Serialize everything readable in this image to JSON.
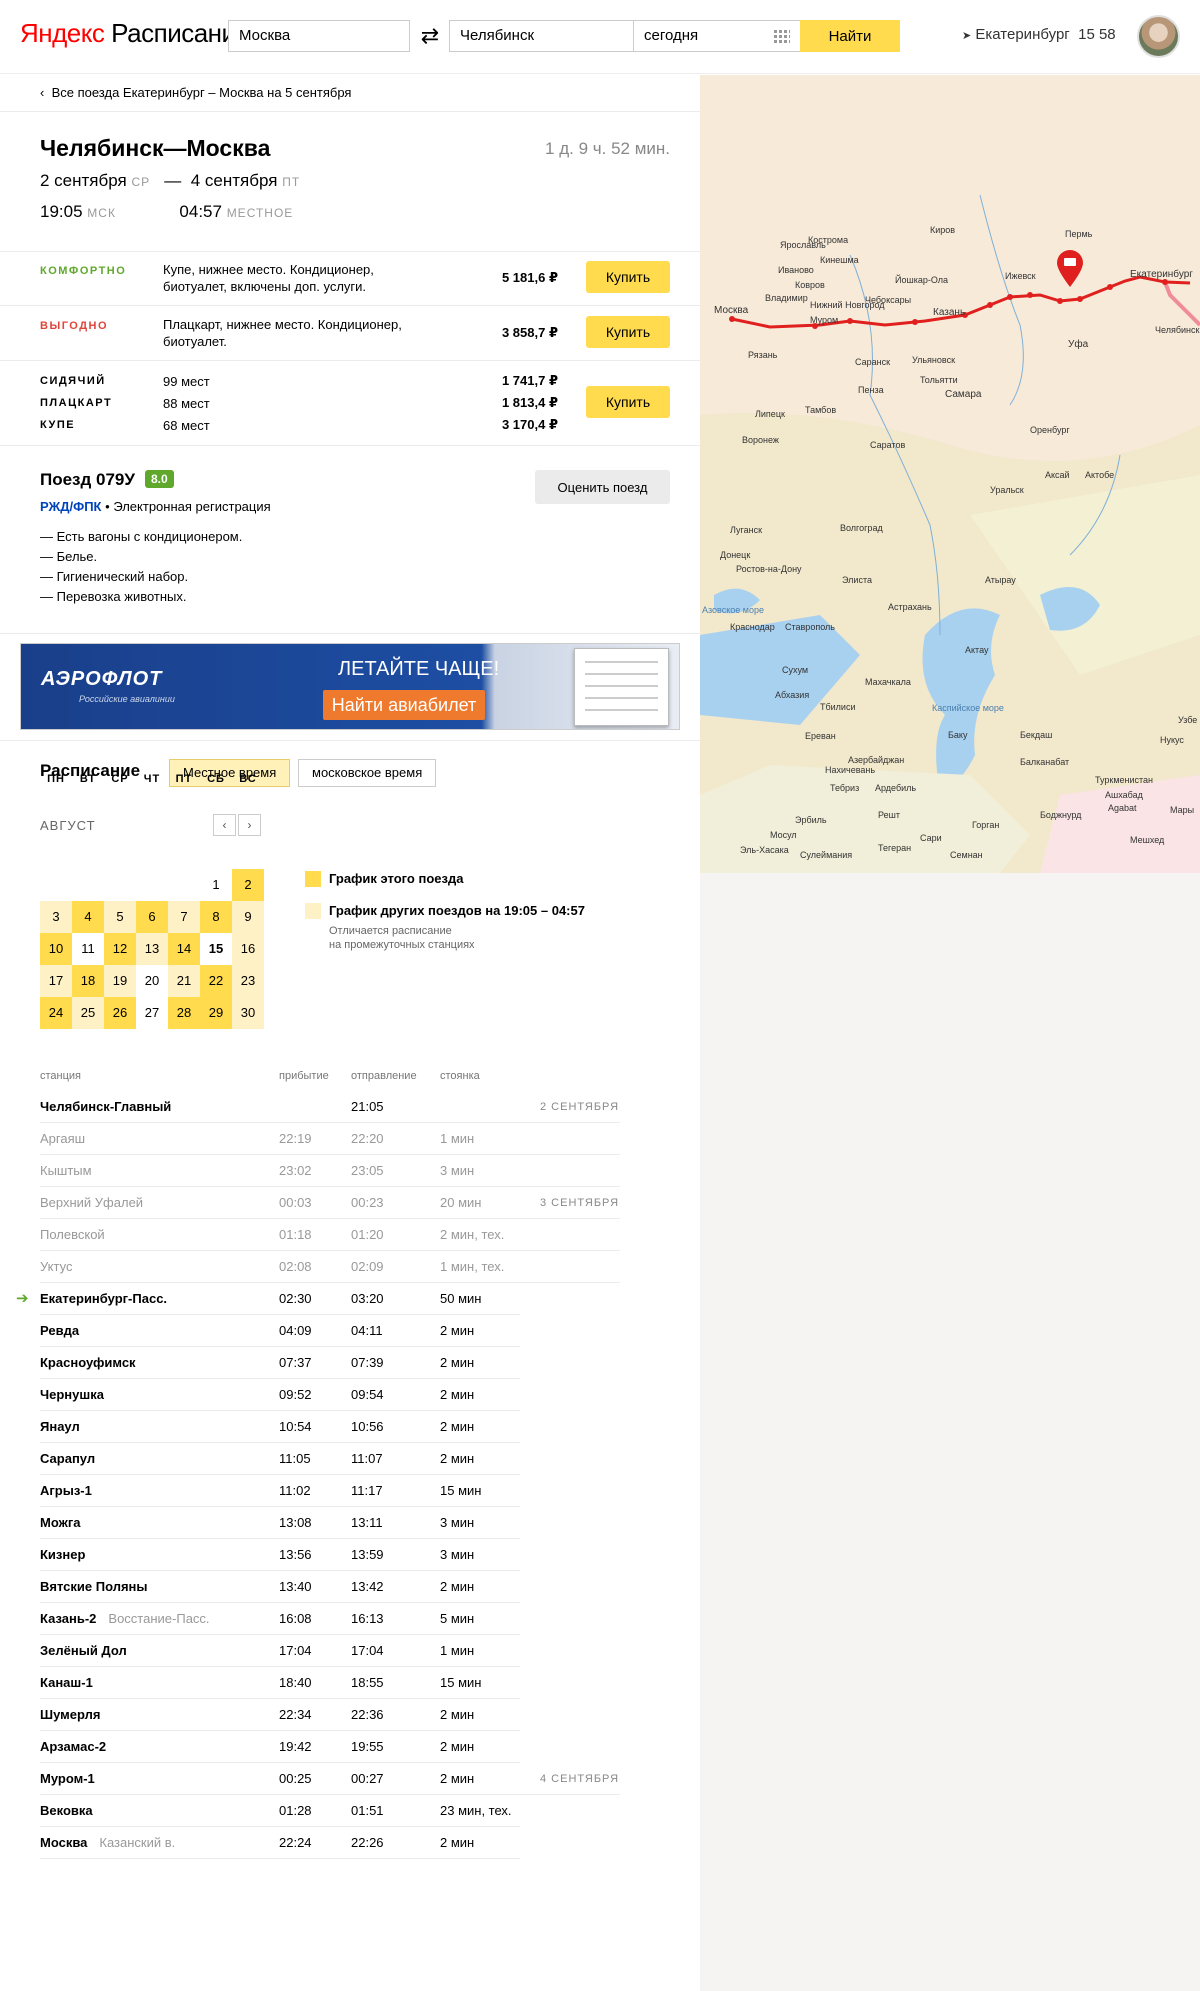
{
  "header": {
    "logo_brand": "Яндекс",
    "logo_service": "Расписания",
    "from_value": "Москва",
    "to_value": "Челябинск",
    "date_value": "сегодня",
    "find_label": "Найти",
    "city": "Екатеринбург",
    "time": "15 58"
  },
  "back_link": "Все поезда Екатеринбург – Москва на 5 сентября",
  "trip": {
    "title": "Челябинск—Москва",
    "duration": "1 д. 9 ч. 52 мин.",
    "dep_date": "2 сентября",
    "dep_dow": "СР",
    "dash": "—",
    "arr_date": "4 сентября",
    "arr_dow": "ПТ",
    "dep_time": "19:05",
    "dep_tz": "МСК",
    "arr_time": "04:57",
    "arr_tz": "МЕСТНОЕ"
  },
  "offers": [
    {
      "tag": "КОМФОРТНО",
      "color": "#5fa82b",
      "desc": "Купе, нижнее место. Кондиционер, биотуалет, включены доп. услуги.",
      "price": "5 181,6 ₽",
      "buy": "Купить"
    },
    {
      "tag": "ВЫГОДНО",
      "color": "#e0453b",
      "desc": "Плацкарт, нижнее место. Кондиционер, биотуалет.",
      "price": "3 858,7 ₽",
      "buy": "Купить"
    }
  ],
  "classes": {
    "rows": [
      {
        "name": "СИДЯЧИЙ",
        "seats": "99 мест",
        "price": "1 741,7 ₽"
      },
      {
        "name": "ПЛАЦКАРТ",
        "seats": "88 мест",
        "price": "1 813,4 ₽"
      },
      {
        "name": "КУПЕ",
        "seats": "68 мест",
        "price": "3 170,4 ₽"
      }
    ],
    "buy": "Купить"
  },
  "train": {
    "name": "Поезд 079У",
    "rating": "8.0",
    "carrier": "РЖД/ФПК",
    "bullet": "•",
    "reg": "Электронная регистрация",
    "features": [
      "— Есть вагоны с кондиционером.",
      "— Белье.",
      "— Гигиенический набор.",
      "— Перевозка животных."
    ],
    "rate_button": "Оценить поезд"
  },
  "banner": {
    "logo": "АЭРОФЛОТ",
    "sub": "Российские авиалинии",
    "headline": "ЛЕТАЙТЕ ЧАЩЕ!",
    "button": "Найти авиабилет"
  },
  "schedule": {
    "title": "Расписание",
    "toggle_local": "Местное время",
    "toggle_msk": "московское время",
    "month": "АВГУСТ",
    "prev": "‹",
    "next": "›",
    "dow": [
      "ПН",
      "ВТ",
      "СР",
      "ЧТ",
      "ПТ",
      "СБ",
      "ВС"
    ],
    "legend_this": "График этого поезда",
    "legend_other": "График  других поездов на 19:05 – 04:57",
    "legend_note1": "Отличается расписание",
    "legend_note2": "на промежуточных станциях"
  },
  "calendar": [
    {
      "d": "1",
      "c": "",
      "s": ""
    },
    {
      "d": "2",
      "c": "y",
      "s": ""
    },
    {
      "d": "3",
      "c": "l",
      "s": ""
    },
    {
      "d": "4",
      "c": "y",
      "s": ""
    },
    {
      "d": "5",
      "c": "l",
      "s": ""
    },
    {
      "d": "6",
      "c": "y",
      "s": ""
    },
    {
      "d": "7",
      "c": "l",
      "s": ""
    },
    {
      "d": "8",
      "c": "y",
      "s": ""
    },
    {
      "d": "9",
      "c": "l",
      "s": ""
    },
    {
      "d": "10",
      "c": "y",
      "s": ""
    },
    {
      "d": "11",
      "c": "",
      "s": ""
    },
    {
      "d": "12",
      "c": "y",
      "s": ""
    },
    {
      "d": "13",
      "c": "l",
      "s": ""
    },
    {
      "d": "14",
      "c": "y",
      "s": ""
    },
    {
      "d": "15",
      "c": "",
      "s": "b"
    },
    {
      "d": "16",
      "c": "l",
      "s": ""
    },
    {
      "d": "17",
      "c": "l",
      "s": ""
    },
    {
      "d": "18",
      "c": "y",
      "s": ""
    },
    {
      "d": "19",
      "c": "l",
      "s": ""
    },
    {
      "d": "20",
      "c": "",
      "s": ""
    },
    {
      "d": "21",
      "c": "l",
      "s": ""
    },
    {
      "d": "22",
      "c": "y",
      "s": ""
    },
    {
      "d": "23",
      "c": "l",
      "s": ""
    },
    {
      "d": "24",
      "c": "y",
      "s": ""
    },
    {
      "d": "25",
      "c": "l",
      "s": ""
    },
    {
      "d": "26",
      "c": "y",
      "s": ""
    },
    {
      "d": "27",
      "c": "",
      "s": ""
    },
    {
      "d": "28",
      "c": "y",
      "s": ""
    },
    {
      "d": "29",
      "c": "y",
      "s": ""
    },
    {
      "d": "30",
      "c": "l",
      "s": ""
    }
  ],
  "table": {
    "h_station": "станция",
    "h_arrival": "прибытие",
    "h_departure": "отправление",
    "h_stop": "стоянка",
    "rows": [
      {
        "st": "Челябинск-Главный",
        "sub": "",
        "arr": "",
        "dep": "21:05",
        "stop": "",
        "dt": "2 СЕНТЯБРЯ",
        "t": "bd"
      },
      {
        "st": "Аргаяш",
        "sub": "",
        "arr": "22:19",
        "dep": "22:20",
        "stop": "1 мин",
        "dt": "",
        "t": "gr"
      },
      {
        "st": "Кыштым",
        "sub": "",
        "arr": "23:02",
        "dep": "23:05",
        "stop": "3 мин",
        "dt": "",
        "t": "gr"
      },
      {
        "st": "Верхний Уфалей",
        "sub": "",
        "arr": "00:03",
        "dep": "00:23",
        "stop": "20 мин",
        "dt": "3 СЕНТЯБРЯ",
        "t": "gr"
      },
      {
        "st": "Полевской",
        "sub": "",
        "arr": "01:18",
        "dep": "01:20",
        "stop": "2 мин, тех.",
        "dt": "",
        "t": "gr"
      },
      {
        "st": "Уктус",
        "sub": "",
        "arr": "02:08",
        "dep": "02:09",
        "stop": "1 мин, тех.",
        "dt": "",
        "t": "gr"
      },
      {
        "st": "Екатеринбург-Пасс.",
        "sub": "",
        "arr": "02:30",
        "dep": "03:20",
        "stop": "50 мин",
        "dt": "",
        "t": "bd",
        "here": true
      },
      {
        "st": "Ревда",
        "sub": "",
        "arr": "04:09",
        "dep": "04:11",
        "stop": "2 мин",
        "dt": "",
        "t": "bd"
      },
      {
        "st": "Красноуфимск",
        "sub": "",
        "arr": "07:37",
        "dep": "07:39",
        "stop": "2 мин",
        "dt": "",
        "t": "bd"
      },
      {
        "st": "Чернушка",
        "sub": "",
        "arr": "09:52",
        "dep": "09:54",
        "stop": "2 мин",
        "dt": "",
        "t": "bd"
      },
      {
        "st": "Янаул",
        "sub": "",
        "arr": "10:54",
        "dep": "10:56",
        "stop": "2 мин",
        "dt": "",
        "t": "bd"
      },
      {
        "st": "Сарапул",
        "sub": "",
        "arr": "11:05",
        "dep": "11:07",
        "stop": "2 мин",
        "dt": "",
        "t": "bd"
      },
      {
        "st": "Агрыз-1",
        "sub": "",
        "arr": "11:02",
        "dep": "11:17",
        "stop": "15 мин",
        "dt": "",
        "t": "bd"
      },
      {
        "st": "Можга",
        "sub": "",
        "arr": "13:08",
        "dep": "13:11",
        "stop": "3 мин",
        "dt": "",
        "t": "bd"
      },
      {
        "st": "Кизнер",
        "sub": "",
        "arr": "13:56",
        "dep": "13:59",
        "stop": "3 мин",
        "dt": "",
        "t": "bd"
      },
      {
        "st": "Вятские Поляны",
        "sub": "",
        "arr": "13:40",
        "dep": "13:42",
        "stop": "2 мин",
        "dt": "",
        "t": "bd"
      },
      {
        "st": "Казань-2",
        "sub": "Восстание-Пасс.",
        "arr": "16:08",
        "dep": "16:13",
        "stop": "5 мин",
        "dt": "",
        "t": "bd"
      },
      {
        "st": "Зелёный Дол",
        "sub": "",
        "arr": "17:04",
        "dep": "17:04",
        "stop": "1 мин",
        "dt": "",
        "t": "bd"
      },
      {
        "st": "Канаш-1",
        "sub": "",
        "arr": "18:40",
        "dep": "18:55",
        "stop": "15 мин",
        "dt": "",
        "t": "bd"
      },
      {
        "st": "Шумерля",
        "sub": "",
        "arr": "22:34",
        "dep": "22:36",
        "stop": "2 мин",
        "dt": "",
        "t": "bd"
      },
      {
        "st": "Арзамас-2",
        "sub": "",
        "arr": "19:42",
        "dep": "19:55",
        "stop": "2 мин",
        "dt": "",
        "t": "bd"
      },
      {
        "st": "Муром-1",
        "sub": "",
        "arr": "00:25",
        "dep": "00:27",
        "stop": "2 мин",
        "dt": "4 СЕНТЯБРЯ",
        "t": "bd"
      },
      {
        "st": "Вековка",
        "sub": "",
        "arr": "01:28",
        "dep": "01:51",
        "stop": "23 мин, тех.",
        "dt": "",
        "t": "bd"
      },
      {
        "st": "Москва",
        "sub": "Казанский в.",
        "arr": "22:24",
        "dep": "22:26",
        "stop": "2 мин",
        "dt": "",
        "t": "bd"
      }
    ]
  },
  "map": {
    "labels": [
      "Москва",
      "Екатеринбург",
      "Челябинск",
      "Казань",
      "Ижевск",
      "Пермь",
      "Уфа",
      "Самара",
      "Саратов",
      "Волгоград",
      "Ростов-на-Дону",
      "Владимир",
      "Нижний Новгород",
      "Йошкар-Ола",
      "Чебоксары",
      "Иваново",
      "Рязань",
      "Тамбов",
      "Пенза",
      "Саранск",
      "Ульяновск",
      "Тольятти",
      "Оренбург",
      "Актобе",
      "Воронеж",
      "Липецк",
      "Луганск",
      "Донецк",
      "Краснодар",
      "Ставрополь",
      "Махачкала",
      "Тбилиси",
      "Ереван",
      "Баку",
      "Сухум",
      "Абхазия",
      "Азербайджан",
      "Нахичевань",
      "Тебриз",
      "Ардебиль",
      "Решт",
      "Тегеран",
      "Сари",
      "Семнан",
      "Туркменистан",
      "Ашхабад",
      "Agabat",
      "Балканабат",
      "Мешхед",
      "Мары",
      "Узбе",
      "Нукус",
      "Каспийское море",
      "Азовское море",
      "Элиста",
      "Астрахань",
      "Атырау",
      "Уральск",
      "Аксай",
      "Бекдаш",
      "Актау",
      "Эль-Хасака",
      "Сулеймания",
      "Мосул",
      "Эрбиль",
      "Горган",
      "Боджнурд",
      "Киров",
      "Ярославль",
      "Кострома",
      "Кинешма",
      "Ковров",
      "Муром"
    ]
  }
}
